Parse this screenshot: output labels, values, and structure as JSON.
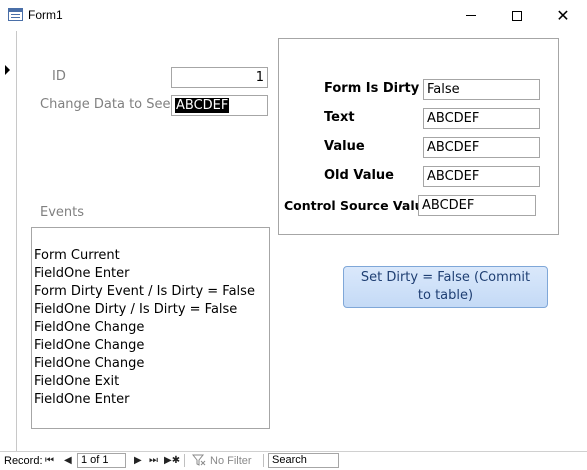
{
  "window": {
    "title": "Form1",
    "minimize_icon": "minimize-icon",
    "maximize_icon": "maximize-icon",
    "close_icon": "close-icon",
    "close_glyph": "✕"
  },
  "form": {
    "id_label": "ID",
    "id_value": "1",
    "change_label": "Change Data to See",
    "change_value": "ABCDEF",
    "events_label": "Events"
  },
  "panel": {
    "form_is_dirty_label": "Form Is Dirty",
    "form_is_dirty_value": "False",
    "text_label": "Text",
    "text_value": "ABCDEF",
    "value_label": "Value",
    "value_value": "ABCDEF",
    "old_value_label": "Old Value",
    "old_value_value": "ABCDEF",
    "control_source_label": "Control Source Value",
    "control_source_value": "ABCDEF"
  },
  "events": [
    "Form Current",
    "FieldOne Enter",
    "Form Dirty Event / Is Dirty = False",
    "FieldOne Dirty / Is Dirty = False",
    "FieldOne Change",
    "FieldOne Change",
    "FieldOne Change",
    "FieldOne Exit",
    "FieldOne Enter"
  ],
  "action_button": {
    "label": "Set Dirty = False (Commit to table)"
  },
  "navigation": {
    "record_label": "Record:",
    "first_glyph": "⏮",
    "prev_glyph": "◀",
    "position": "1 of 1",
    "next_glyph": "▶",
    "last_glyph": "⏭",
    "new_glyph": "▶✱",
    "filter_label": "No Filter",
    "search_placeholder": "Search"
  }
}
